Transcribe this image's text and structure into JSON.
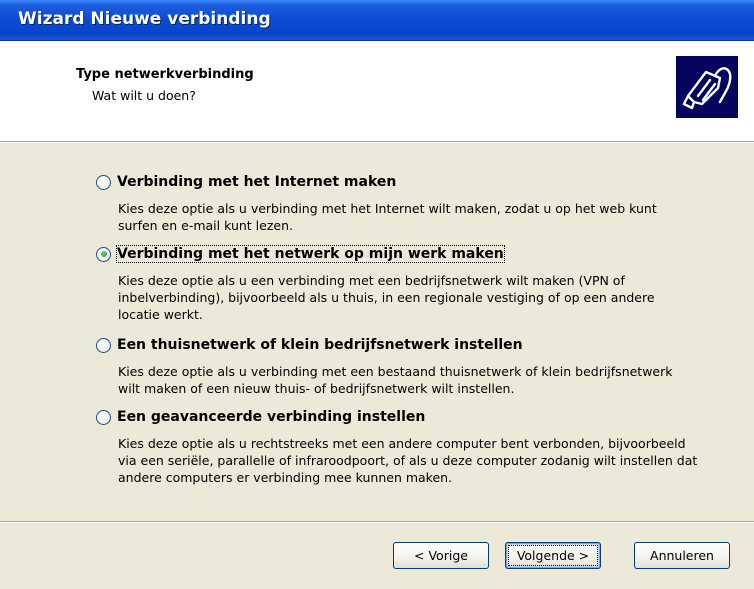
{
  "window": {
    "title": "Wizard Nieuwe verbinding"
  },
  "header": {
    "title": "Type netwerkverbinding",
    "subtitle": "Wat wilt u doen?",
    "icon": "network-plug-icon"
  },
  "options": [
    {
      "label": "Verbinding met het Internet maken",
      "checked": false,
      "description": "Kies deze optie als u verbinding met het Internet wilt maken, zodat u op het web kunt surfen en e-mail kunt lezen."
    },
    {
      "label": "Verbinding met het netwerk op mijn werk maken",
      "checked": true,
      "description": "Kies deze optie als u een verbinding met een bedrijfsnetwerk wilt maken (VPN of inbelverbinding), bijvoorbeeld als u thuis, in een regionale vestiging of op een andere locatie werkt."
    },
    {
      "label": "Een thuisnetwerk of klein bedrijfsnetwerk instellen",
      "checked": false,
      "description": "Kies deze optie als u verbinding met een bestaand thuisnetwerk of klein bedrijfsnetwerk wilt maken of een nieuw thuis- of bedrijfsnetwerk wilt instellen."
    },
    {
      "label": "Een geavanceerde verbinding instellen",
      "checked": false,
      "description": "Kies deze optie als u rechtstreeks met een andere computer bent verbonden, bijvoorbeeld via een seriële, parallelle of infraroodpoort, of als u deze computer zodanig wilt instellen dat andere computers er verbinding mee kunnen maken."
    }
  ],
  "buttons": {
    "back": "< Vorige",
    "next": "Volgende >",
    "cancel": "Annuleren"
  },
  "colors": {
    "titlebar": "#0a4ad0",
    "dialog_bg": "#ece9d8",
    "radio_selected": "#21a121"
  }
}
